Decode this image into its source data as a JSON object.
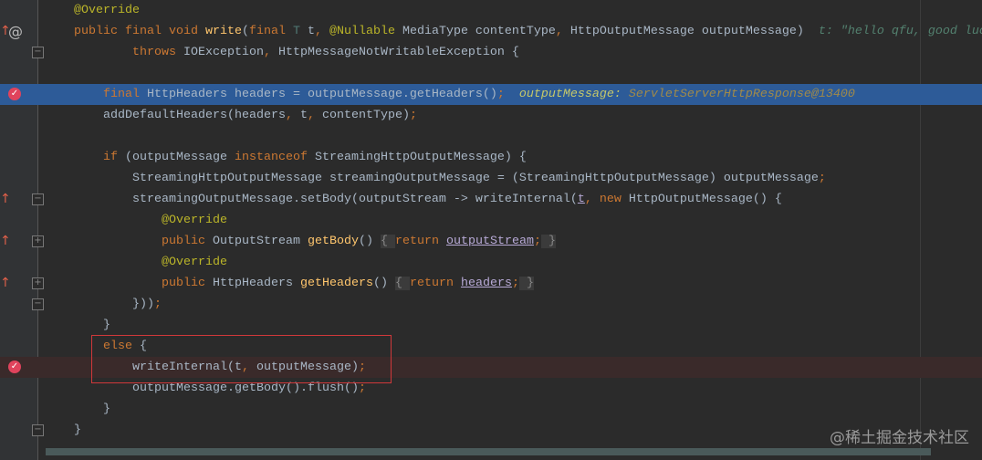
{
  "editor": {
    "lines": [
      {
        "indent": 0,
        "tokens": [
          [
            "ann",
            "@Override"
          ]
        ]
      },
      {
        "indent": 0,
        "tokens": [
          [
            "kw",
            "public final void "
          ],
          [
            "fn",
            "write"
          ],
          [
            "",
            "("
          ],
          [
            "kw",
            "final "
          ],
          [
            "tp",
            "T"
          ],
          [
            "",
            " t"
          ],
          [
            "kw",
            ", "
          ],
          [
            "ann",
            "@Nullable "
          ],
          [
            "",
            "MediaType contentType"
          ],
          [
            "kw",
            ", "
          ],
          [
            "",
            "HttpOutputMessage outputMessage)  "
          ],
          [
            "hint",
            "t: \"hello qfu, good luck\""
          ]
        ]
      },
      {
        "indent": 2,
        "tokens": [
          [
            "kw",
            "throws "
          ],
          [
            "",
            "IOException"
          ],
          [
            "kw",
            ", "
          ],
          [
            "",
            "HttpMessageNotWritableException {"
          ]
        ]
      },
      {
        "indent": 0,
        "tokens": []
      },
      {
        "indent": 1,
        "tokens": [
          [
            "kw",
            "final "
          ],
          [
            "",
            "HttpHeaders headers = outputMessage.getHeaders()"
          ],
          [
            "kw",
            ";  "
          ],
          [
            "hname",
            "outputMessage: "
          ],
          [
            "hval",
            "ServletServerHttpResponse@13400"
          ]
        ]
      },
      {
        "indent": 1,
        "tokens": [
          [
            "",
            "addDefaultHeaders(headers"
          ],
          [
            "kw",
            ", "
          ],
          [
            "",
            "t"
          ],
          [
            "kw",
            ", "
          ],
          [
            "",
            "contentType)"
          ],
          [
            "kw",
            ";"
          ]
        ]
      },
      {
        "indent": 0,
        "tokens": []
      },
      {
        "indent": 1,
        "tokens": [
          [
            "kw",
            "if "
          ],
          [
            "",
            "(outputMessage "
          ],
          [
            "kw",
            "instanceof "
          ],
          [
            "",
            "StreamingHttpOutputMessage) {"
          ]
        ]
      },
      {
        "indent": 2,
        "tokens": [
          [
            "",
            "StreamingHttpOutputMessage streamingOutputMessage = (StreamingHttpOutputMessage) outputMessage"
          ],
          [
            "kw",
            ";"
          ]
        ]
      },
      {
        "indent": 2,
        "tokens": [
          [
            "",
            "streamingOutputMessage.setBody(outputStream -> writeInternal("
          ],
          [
            "ul",
            "t"
          ],
          [
            "kw",
            ", new "
          ],
          [
            "",
            "HttpOutputMessage() {"
          ]
        ]
      },
      {
        "indent": 3,
        "tokens": [
          [
            "ann",
            "@Override"
          ]
        ]
      },
      {
        "indent": 3,
        "tokens": [
          [
            "kw",
            "public "
          ],
          [
            "",
            "OutputStream "
          ],
          [
            "fn",
            "getBody"
          ],
          [
            "",
            "() "
          ],
          [
            "fold",
            "{ "
          ],
          [
            "kw",
            "return "
          ],
          [
            "ul",
            "outputStream"
          ],
          [
            "kw",
            ";"
          ],
          [
            "fold",
            " }"
          ]
        ]
      },
      {
        "indent": 3,
        "tokens": [
          [
            "ann",
            "@Override"
          ]
        ]
      },
      {
        "indent": 3,
        "tokens": [
          [
            "kw",
            "public "
          ],
          [
            "",
            "HttpHeaders "
          ],
          [
            "fn",
            "getHeaders"
          ],
          [
            "",
            "() "
          ],
          [
            "fold",
            "{ "
          ],
          [
            "kw",
            "return "
          ],
          [
            "ul",
            "headers"
          ],
          [
            "kw",
            ";"
          ],
          [
            "fold",
            " }"
          ]
        ]
      },
      {
        "indent": 2,
        "tokens": [
          [
            "",
            "}))"
          ],
          [
            "kw",
            ";"
          ]
        ]
      },
      {
        "indent": 1,
        "tokens": [
          [
            "",
            "}"
          ]
        ]
      },
      {
        "indent": 1,
        "tokens": [
          [
            "kw",
            "else "
          ],
          [
            "",
            "{"
          ]
        ]
      },
      {
        "indent": 2,
        "tokens": [
          [
            "",
            "writeInternal(t"
          ],
          [
            "kw",
            ", "
          ],
          [
            "",
            "outputMessage)"
          ],
          [
            "kw",
            ";"
          ]
        ]
      },
      {
        "indent": 2,
        "tokens": [
          [
            "",
            "outputMessage.getBody().flush()"
          ],
          [
            "kw",
            ";"
          ]
        ]
      },
      {
        "indent": 1,
        "tokens": [
          [
            "",
            "}"
          ]
        ]
      },
      {
        "indent": 0,
        "tokens": [
          [
            "",
            "}"
          ]
        ]
      }
    ],
    "exec_line": 4,
    "breakpoint_lines": [
      4,
      17
    ],
    "override_marker_lines": [
      1,
      9,
      11,
      13
    ],
    "fold_lines": {
      "2": "−",
      "9": "−",
      "11": "+",
      "13": "+",
      "14": "−",
      "20": "−"
    }
  },
  "watermark": "@稀土掘金技术社区"
}
